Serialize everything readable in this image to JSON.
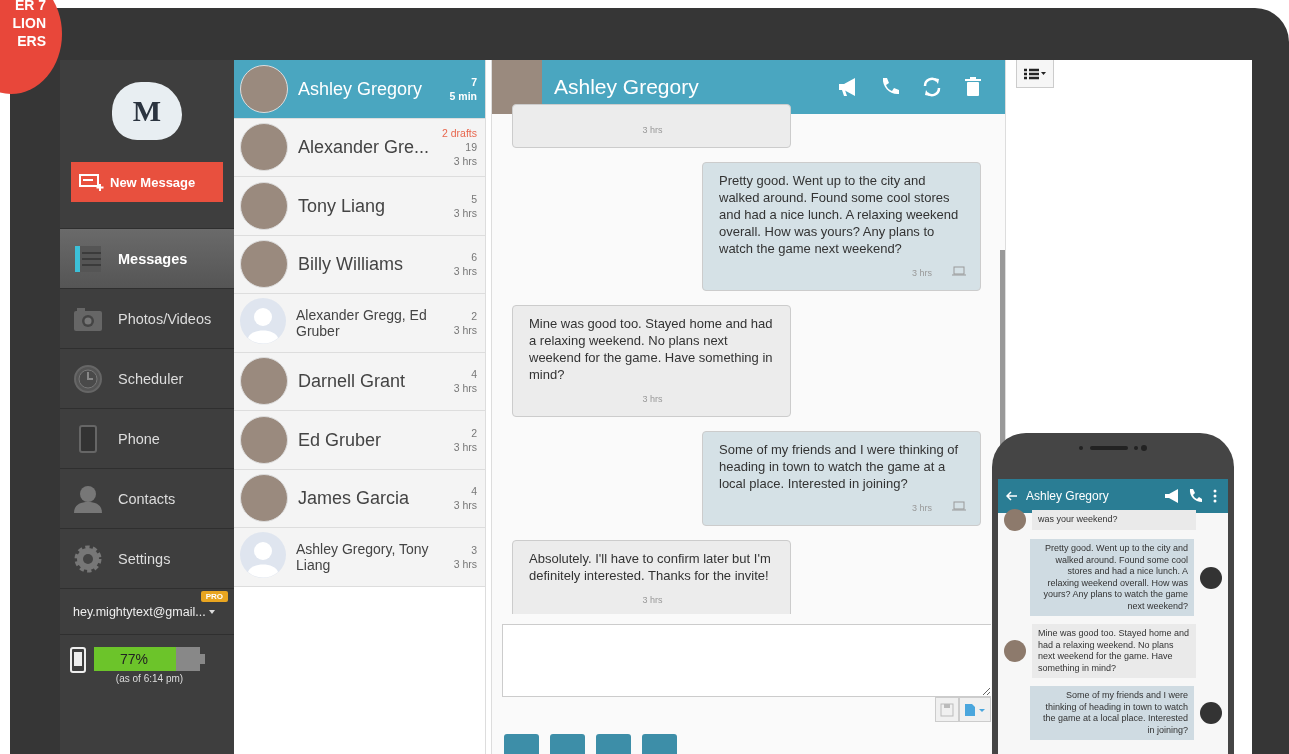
{
  "badge": {
    "lines": [
      "ER 7",
      "LION",
      "ERS"
    ]
  },
  "sidebar": {
    "logo_text": "M",
    "new_message_button": "New Message",
    "nav": [
      {
        "label": "Messages",
        "selected": true
      },
      {
        "label": "Photos/Videos",
        "selected": false
      },
      {
        "label": "Scheduler",
        "selected": false
      },
      {
        "label": "Phone",
        "selected": false
      },
      {
        "label": "Contacts",
        "selected": false
      },
      {
        "label": "Settings",
        "selected": false
      }
    ],
    "account": {
      "email": "hey.mightytext@gmail...",
      "badge": "PRO"
    },
    "battery": {
      "level": 0.77,
      "reading": "77%",
      "note": "(as of 6:14 pm)"
    }
  },
  "conversations": [
    {
      "name": "Ashley Gregory",
      "count": "7",
      "time": "5 min",
      "kind": "photo",
      "selected": true
    },
    {
      "name": "Alexander Gre...",
      "drafts": "2 drafts",
      "count": "19",
      "time": "3 hrs",
      "kind": "photo",
      "selected": false
    },
    {
      "name": "Tony Liang",
      "count": "5",
      "time": "3 hrs",
      "kind": "photo",
      "selected": false
    },
    {
      "name": "Billy Williams",
      "count": "6",
      "time": "3 hrs",
      "kind": "photo",
      "selected": false
    },
    {
      "name": "Alexander Gregg, Ed Gruber",
      "count": "2",
      "time": "3 hrs",
      "kind": "silhouette",
      "selected": false
    },
    {
      "name": "Darnell Grant",
      "count": "4",
      "time": "3 hrs",
      "kind": "photo",
      "selected": false
    },
    {
      "name": "Ed Gruber",
      "count": "2",
      "time": "3 hrs",
      "kind": "photo",
      "selected": false
    },
    {
      "name": "James Garcia",
      "count": "4",
      "time": "3 hrs",
      "kind": "photo",
      "selected": false
    },
    {
      "name": "Ashley Gregory, Tony Liang",
      "count": "3",
      "time": "3 hrs",
      "kind": "silhouette",
      "selected": false
    }
  ],
  "chat": {
    "contact": "Ashley Gregory",
    "messages": [
      {
        "kind": "received",
        "time": "3 hrs"
      },
      {
        "kind": "sent",
        "text": "Pretty good. Went up to the city and walked around. Found some cool stores and had a nice lunch. A relaxing weekend overall. How was yours? Any plans to watch the game next weekend?",
        "time": "3 hrs"
      },
      {
        "kind": "received",
        "text": "Mine was good too.  Stayed home and had a relaxing weekend.  No plans next weekend for the game.  Have something in mind?",
        "time": "3 hrs"
      },
      {
        "kind": "sent",
        "text": "Some of my friends and I were thinking of heading in town to watch the game at a local place. Interested in joining?",
        "time": "3 hrs"
      },
      {
        "kind": "received",
        "text": "Absolutely.  I'll have to confirm later but I'm definitely interested.  Thanks for the invite!",
        "time": "3 hrs"
      }
    ]
  },
  "phone": {
    "contact": "Ashley Gregory",
    "messages": [
      {
        "kind": "received",
        "text": "was your weekend?"
      },
      {
        "kind": "sent",
        "text": "Pretty good. Went up to the city and walked around. Found some cool stores and had a nice lunch. A relaxing weekend overall. How was yours? Any plans to watch the game next weekend?"
      },
      {
        "kind": "received",
        "text": "Mine was good too.  Stayed home and had a relaxing weekend.  No plans next weekend for the game.  Have something in mind?"
      },
      {
        "kind": "sent",
        "text": "Some of my friends and I were thinking of heading in town to watch the game at a local place. Interested in joining?"
      }
    ]
  }
}
